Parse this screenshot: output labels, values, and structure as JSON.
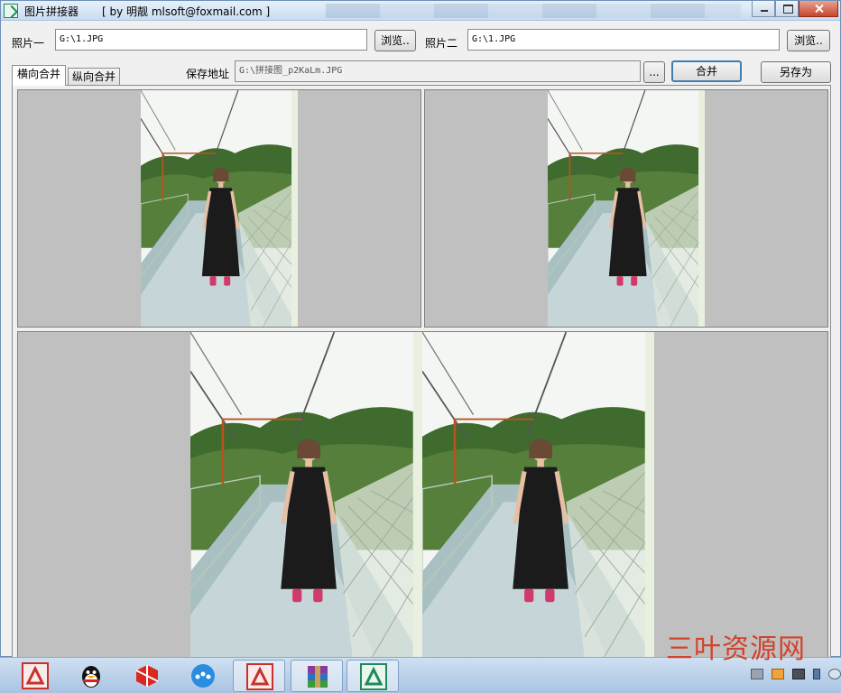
{
  "window": {
    "title": "图片拼接器",
    "credit": "[ by 明靓  mlsoft@foxmail.com ]"
  },
  "form": {
    "photo1_label": "照片一",
    "photo1_value": "G:\\1.JPG",
    "browse1_label": "浏览..",
    "photo2_label": "照片二",
    "photo2_value": "G:\\1.JPG",
    "browse2_label": "浏览..",
    "save_label": "保存地址",
    "save_value": "G:\\拼接图_p2KaLm.JPG",
    "save_browse_label": "...",
    "merge_label": "合并",
    "save_as_label": "另存为"
  },
  "tabs": [
    {
      "label": "横向合并",
      "active": true
    },
    {
      "label": "纵向合并",
      "active": false
    }
  ],
  "colors": {
    "pane_background": "#c0c0c0",
    "watermark": "#d2432b",
    "window_border": "#6d8fb6"
  },
  "taskbar": {
    "items": [
      {
        "icon": "image-joiner-red-icon"
      },
      {
        "icon": "qq-penguin-icon"
      },
      {
        "icon": "sketchup-icon"
      },
      {
        "icon": "chat-bubble-icon"
      },
      {
        "icon": "image-joiner-red-icon"
      },
      {
        "icon": "winrar-icon"
      },
      {
        "icon": "image-joiner-green-icon"
      }
    ],
    "tray": [
      "keyboard-icon",
      "window-icon",
      "battery-icon",
      "usb-icon",
      "volume-icon"
    ]
  },
  "watermark": "三叶资源网"
}
